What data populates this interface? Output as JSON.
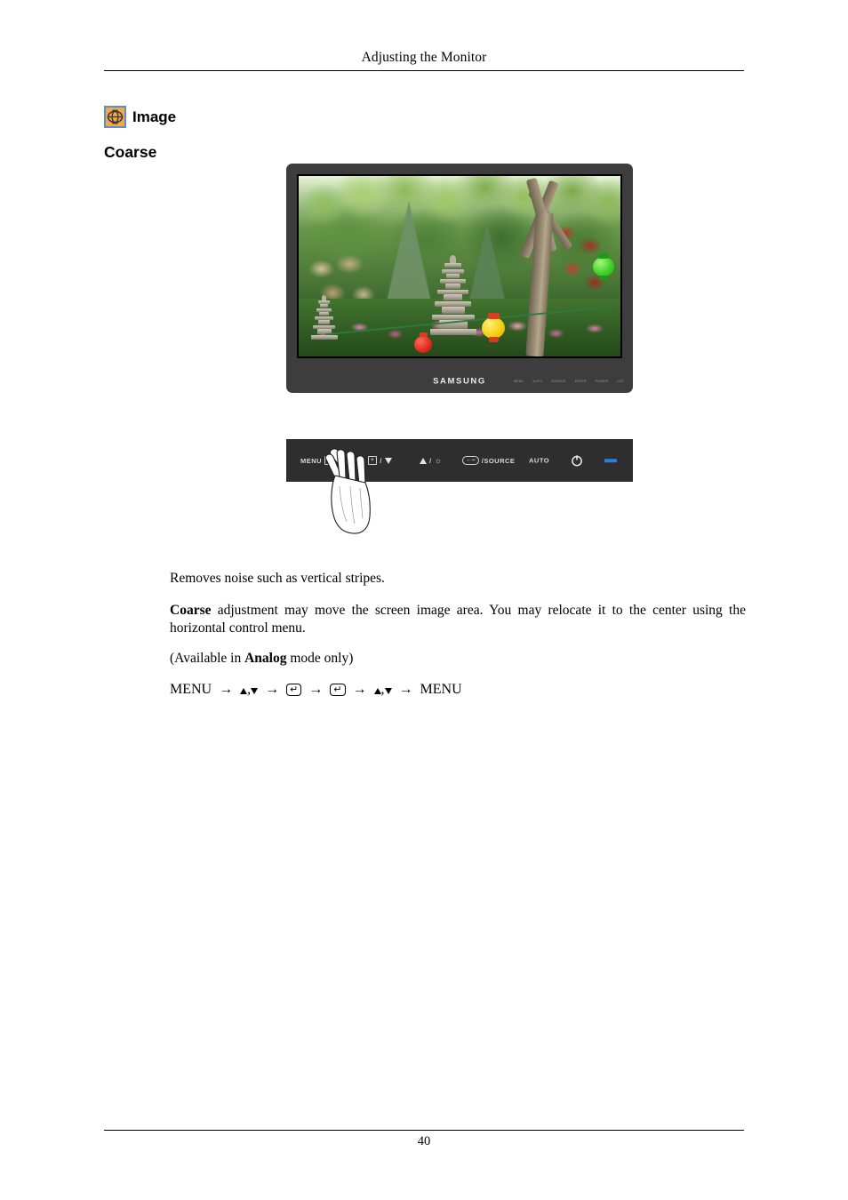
{
  "page": {
    "running_header": "Adjusting the Monitor",
    "page_number": "40"
  },
  "section": {
    "icon": "image-globe-icon",
    "icon_bg_color": "#f4a946",
    "icon_border_color": "#5a8fd6",
    "title": "Image",
    "sub_heading": "Coarse"
  },
  "figure_monitor": {
    "name": "samsung-monitor-photo",
    "brand_logo": "SAMSUNG",
    "frame_color": "#3d3d3d",
    "bezel_keys": [
      "MENU",
      "AUTO",
      "SOURCE",
      "ENTER",
      "POWER",
      "LED"
    ],
    "screen_photo": {
      "description": "Korean garden with stone pagodas, green trees, pink flowers and paper lanterns",
      "elements": [
        "stone-pagoda-large",
        "stone-pagoda-small",
        "tree-trunk",
        "red-lantern",
        "yellow-lantern",
        "green-lantern",
        "pink-flowers",
        "green-rope"
      ]
    }
  },
  "figure_panel": {
    "name": "monitor-control-panel",
    "background_color": "#2e2e2e",
    "led_color": "#2f7de0",
    "hand_overlay": "hand-pressing-menu-button",
    "keys": [
      {
        "name": "menu-key",
        "label": "MENU",
        "glyph": "box-icon"
      },
      {
        "name": "down-key",
        "label": "/",
        "glyph": "box-plus-icon",
        "trailing_glyph": "triangle-down"
      },
      {
        "name": "up-key",
        "label": "/",
        "glyph": "triangle-up",
        "trailing_glyph": "brightness-sun-icon"
      },
      {
        "name": "source-key",
        "label": "/SOURCE",
        "glyph": "enter-round-icon"
      },
      {
        "name": "auto-key",
        "label": "AUTO",
        "glyph": ""
      },
      {
        "name": "power-key",
        "label": "",
        "glyph": "power-icon"
      },
      {
        "name": "power-led",
        "label": "",
        "glyph": "led-bar"
      }
    ]
  },
  "body": {
    "paragraph_1": "Removes noise such as vertical stripes.",
    "paragraph_2_bold_lead": "Coarse",
    "paragraph_2_rest": " adjustment may move the screen image area. You may relocate it to the center using the horizontal control menu.",
    "paragraph_3_pre": "(Available in ",
    "paragraph_3_bold": "Analog",
    "paragraph_3_post": " mode only)",
    "nav_path": {
      "start": "MENU",
      "end": "MENU",
      "arrow": "→",
      "comma": ",",
      "enter_glyph": "↵"
    }
  }
}
